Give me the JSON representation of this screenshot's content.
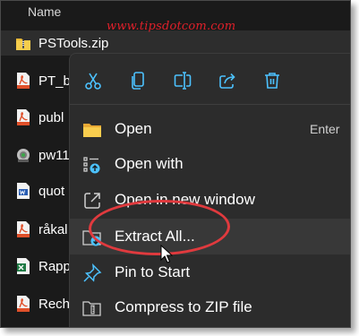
{
  "explorer": {
    "column_header": "Name",
    "files": [
      {
        "name": "PSTools.zip",
        "icon": "zip-folder-icon",
        "selected": true
      },
      {
        "name": "PT_b",
        "icon": "pdf-file-icon"
      },
      {
        "name": "publ",
        "icon": "pdf-file-icon"
      },
      {
        "name": "pw11",
        "icon": "setup-exe-icon"
      },
      {
        "name": "quot",
        "icon": "word-file-icon"
      },
      {
        "name": "råkal",
        "icon": "pdf-file-icon"
      },
      {
        "name": "Rapp",
        "icon": "excel-file-icon"
      },
      {
        "name": "Rech",
        "icon": "pdf-file-icon"
      }
    ]
  },
  "watermark": "www.tipsdotcom.com",
  "context_menu": {
    "toolbar": [
      {
        "name": "cut-icon",
        "label": "Cut"
      },
      {
        "name": "copy-icon",
        "label": "Copy"
      },
      {
        "name": "rename-icon",
        "label": "Rename"
      },
      {
        "name": "share-icon",
        "label": "Share"
      },
      {
        "name": "delete-icon",
        "label": "Delete"
      }
    ],
    "items": [
      {
        "label": "Open",
        "shortcut": "Enter",
        "icon": "folder-icon"
      },
      {
        "label": "Open with",
        "icon": "open-with-icon"
      },
      {
        "label": "Open in new window",
        "icon": "open-new-window-icon"
      },
      {
        "label": "Extract All...",
        "icon": "extract-icon",
        "hovered": true
      },
      {
        "label": "Pin to Start",
        "icon": "pin-icon"
      },
      {
        "label": "Compress to ZIP file",
        "icon": "zip-icon"
      }
    ]
  },
  "colors": {
    "background": "#1a1a1a",
    "menu": "#2c2c2c",
    "highlight_ring": "#e03a3e",
    "watermark": "#e0202a",
    "icon_blue": "#4cc2ff"
  }
}
